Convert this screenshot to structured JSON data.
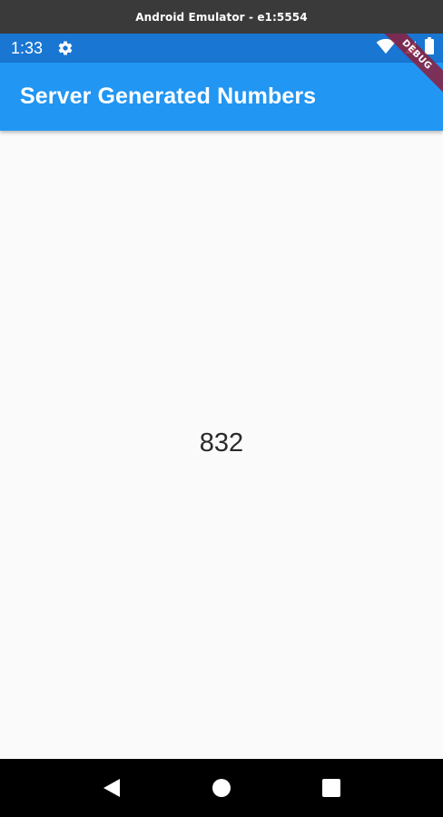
{
  "emulator": {
    "title": "Android Emulator - e1:5554"
  },
  "status_bar": {
    "time": "1:33",
    "icons": [
      "settings-gear-icon",
      "wifi-icon",
      "signal-icon",
      "battery-icon"
    ]
  },
  "app_bar": {
    "title": "Server Generated Numbers"
  },
  "main": {
    "number": "832"
  },
  "debug_banner": {
    "label": "DEBUG"
  },
  "nav_bar": {
    "buttons": [
      "back-icon",
      "home-icon",
      "recents-icon"
    ]
  },
  "colors": {
    "status_bar": "#1976d2",
    "app_bar": "#2196f3",
    "background": "#fafafa",
    "debug_ribbon": "#8c1e3c"
  }
}
